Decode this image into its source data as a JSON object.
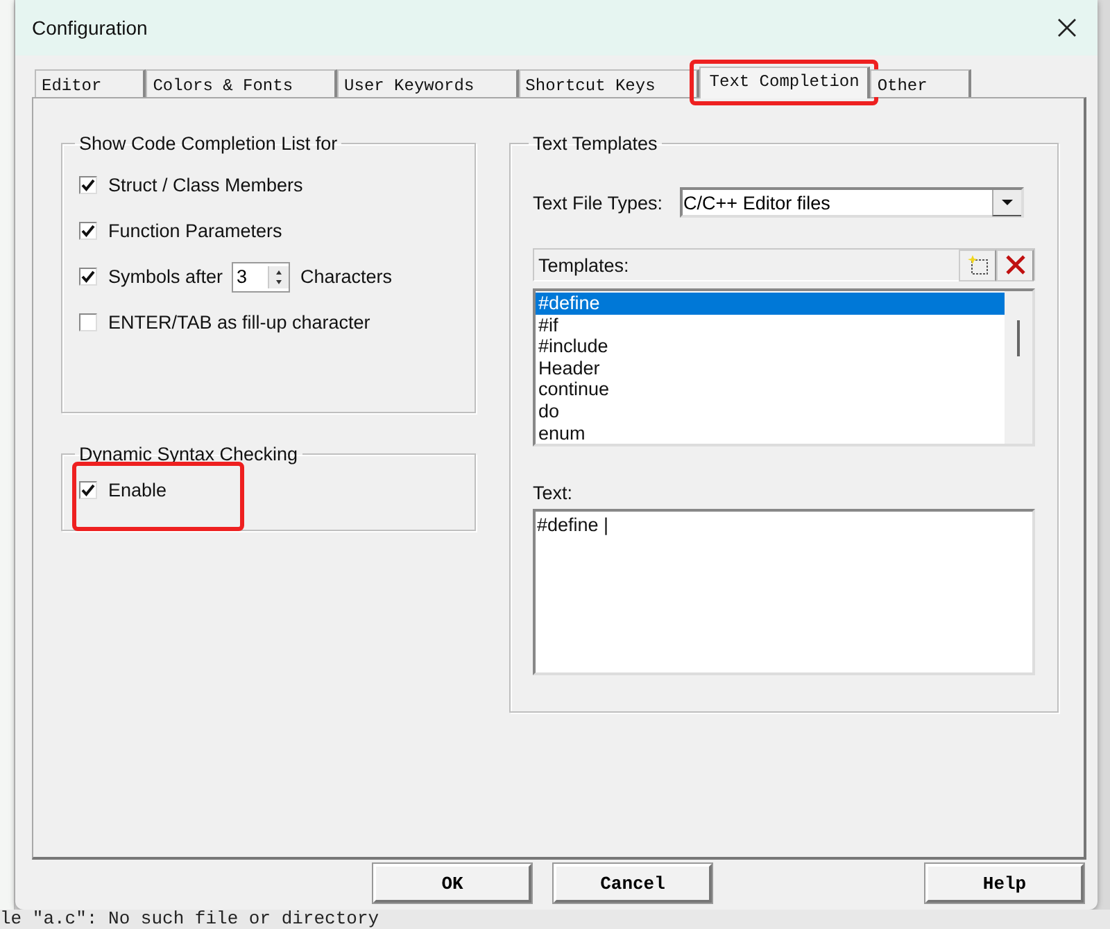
{
  "window": {
    "title": "Configuration"
  },
  "tabs": [
    {
      "label": "Editor",
      "selected": false,
      "annotated": false
    },
    {
      "label": "Colors & Fonts",
      "selected": false,
      "annotated": false
    },
    {
      "label": "User Keywords",
      "selected": false,
      "annotated": false
    },
    {
      "label": "Shortcut Keys",
      "selected": false,
      "annotated": false
    },
    {
      "label": "Text Completion",
      "selected": true,
      "annotated": true
    },
    {
      "label": "Other",
      "selected": false,
      "annotated": false
    }
  ],
  "completion_group": {
    "title": "Show Code Completion List for",
    "options": [
      {
        "kind": "check",
        "label": "Struct / Class Members",
        "checked": true,
        "annotated": false
      },
      {
        "kind": "check",
        "label": "Function Parameters",
        "checked": true,
        "annotated": false
      },
      {
        "kind": "spin",
        "label": "Symbols after",
        "value": "3",
        "suffix": "Characters",
        "checked": true,
        "annotated": false
      },
      {
        "kind": "check",
        "label": "ENTER/TAB as fill-up character",
        "checked": false,
        "annotated": false
      }
    ]
  },
  "syntax_group": {
    "title": "Dynamic Syntax Checking",
    "options": [
      {
        "kind": "check",
        "label": "Enable",
        "checked": true,
        "annotated": true
      }
    ]
  },
  "templates_group": {
    "title": "Text Templates",
    "file_types_label": "Text File Types:",
    "file_types_value": "C/C++ Editor files",
    "templates_label": "Templates:",
    "templates": [
      {
        "label": "#define",
        "selected": true
      },
      {
        "label": "#if",
        "selected": false
      },
      {
        "label": "#include",
        "selected": false
      },
      {
        "label": "Header",
        "selected": false
      },
      {
        "label": "continue",
        "selected": false
      },
      {
        "label": "do",
        "selected": false
      },
      {
        "label": "enum",
        "selected": false
      }
    ],
    "text_label": "Text:",
    "text_value": "#define |"
  },
  "buttons": [
    "OK",
    "Cancel",
    "Help"
  ],
  "console_line": "le \"a.c\": No such file or directory"
}
